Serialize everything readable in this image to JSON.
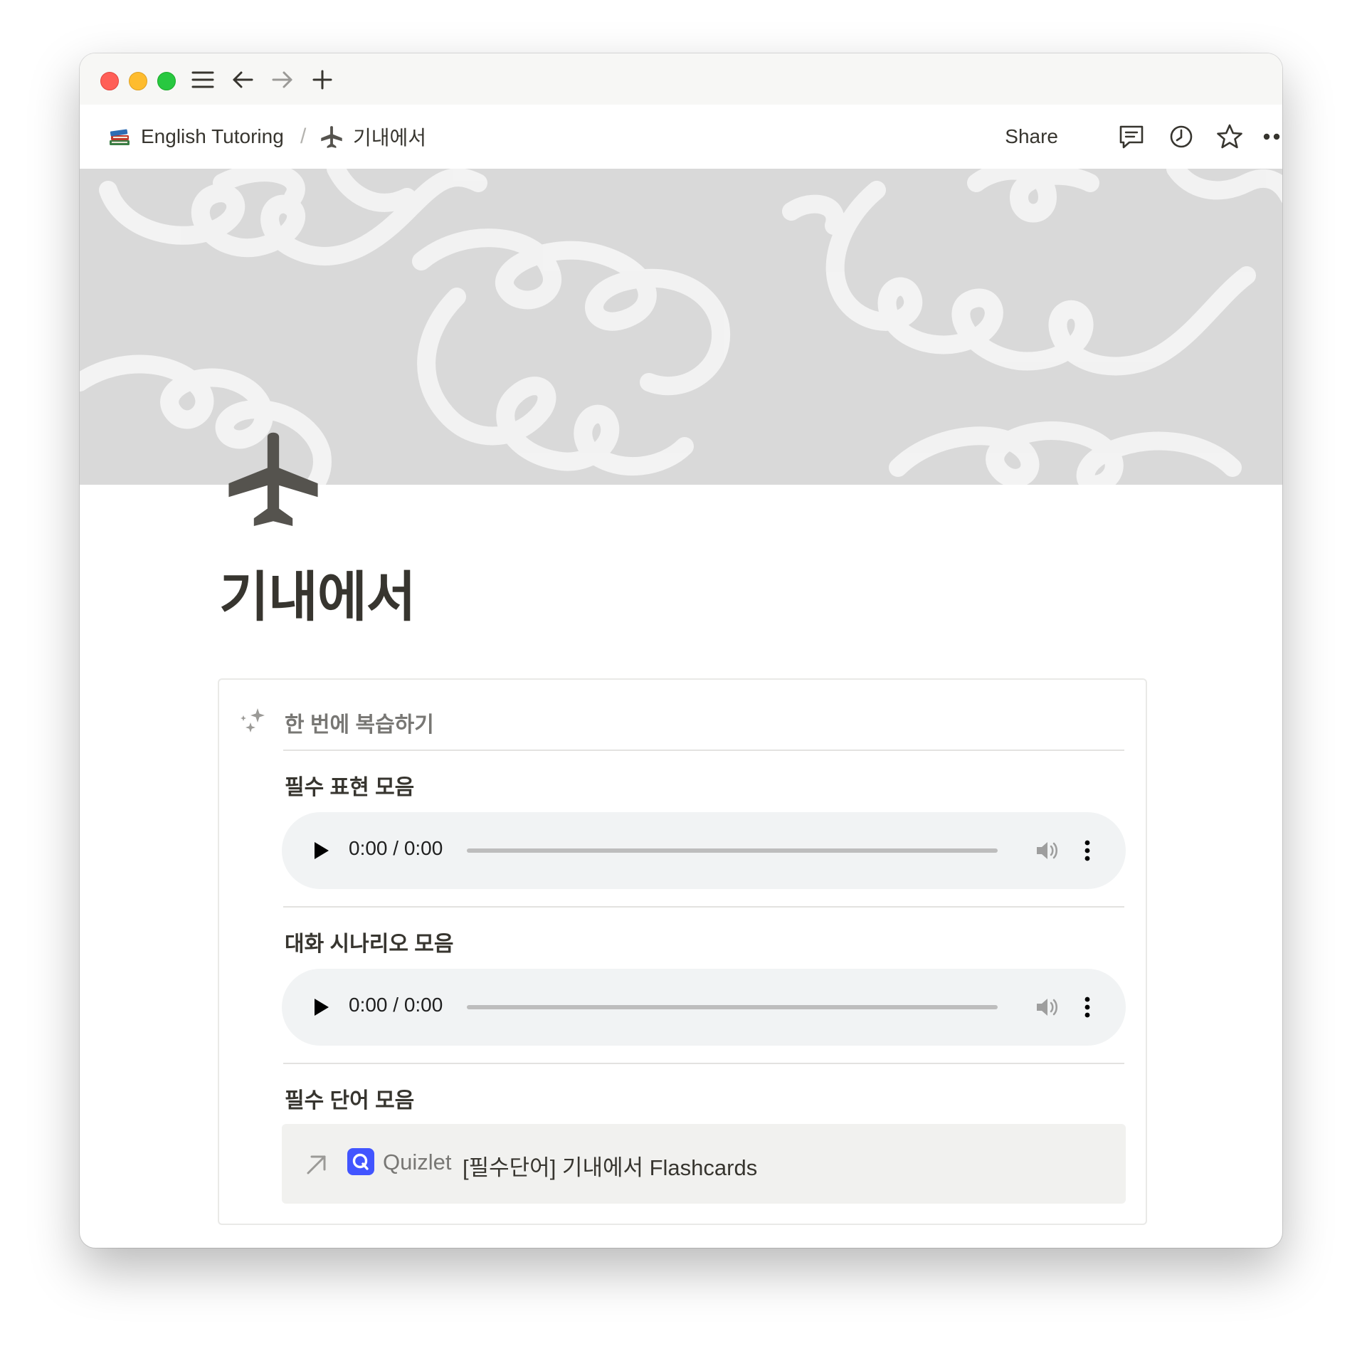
{
  "breadcrumb": {
    "workspace_icon": "books-emoji",
    "workspace": "English Tutoring",
    "separator": "/",
    "page_icon": "airplane-icon",
    "page": "기내에서"
  },
  "topbar": {
    "share_label": "Share",
    "icons": [
      "comment-icon",
      "history-clock-icon",
      "star-icon",
      "more-horizontal-icon"
    ]
  },
  "titlebar": {
    "icons": [
      "sidebar-menu-icon",
      "back-arrow-icon",
      "forward-arrow-icon",
      "new-tab-plus-icon"
    ]
  },
  "page": {
    "icon": "airplane-icon",
    "title": "기내에서",
    "cover": "white-swirl-pattern-on-gray"
  },
  "callout": {
    "icon": "sparkles-icon",
    "title": "한 번에 복습하기",
    "sections": [
      {
        "label": "필수 표현 모음",
        "audio_time": "0:00 / 0:00"
      },
      {
        "label": "대화 시나리오 모음",
        "audio_time": "0:00 / 0:00"
      },
      {
        "label": "필수 단어 모음"
      }
    ],
    "bookmark": {
      "icon": "arrow-up-right-icon",
      "logo": "quizlet-logo",
      "site": "Quizlet",
      "title": "[필수단어] 기내에서 Flashcards"
    }
  },
  "colors": {
    "accent_quizlet": "#4255ff",
    "cover_bg": "#d9d9d9",
    "audio_bg": "#f1f3f4"
  }
}
